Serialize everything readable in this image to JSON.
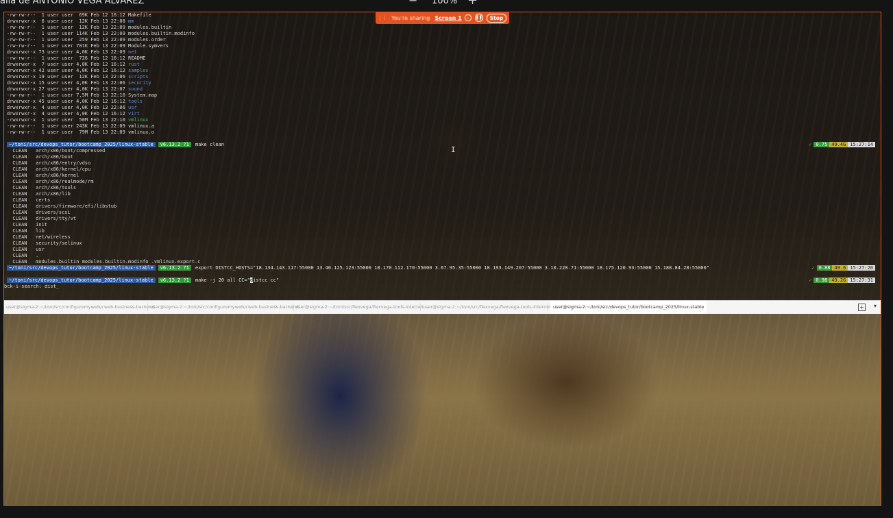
{
  "window": {
    "title": "alla de ANTONIO VEGA ALVAREZ",
    "zoom_minus": "−",
    "zoom_level": "100%",
    "zoom_plus": "+"
  },
  "share_bar": {
    "grip": "⋮⋮",
    "status": "You're sharing",
    "screen": "Screen 1",
    "chevron": "⌄",
    "pause": "❚❚",
    "stop": "Stop"
  },
  "terminal": {
    "listing": [
      {
        "text": "-rw-rw-r--  1 user user  69K Feb 12 16:12 Makefile",
        "kind": "file"
      },
      {
        "text": "drwxrwxr-x  6 user user  12K Feb 13 22:08 ",
        "name": "mm",
        "kind": "dir"
      },
      {
        "text": "-rw-rw-r--  1 user user  12K Feb 13 22:09 modules.builtin",
        "kind": "file"
      },
      {
        "text": "-rw-rw-r--  1 user user 114K Feb 13 22:09 modules.builtin.modinfo",
        "kind": "file"
      },
      {
        "text": "-rw-rw-r--  1 user user  259 Feb 13 22:09 modules.order",
        "kind": "file"
      },
      {
        "text": "-rw-rw-r--  1 user user 701K Feb 13 22:09 Module.symvers",
        "kind": "file"
      },
      {
        "text": "drwxrwxr-x 73 user user 4,0K Feb 13 22:09 ",
        "name": "net",
        "kind": "dir"
      },
      {
        "text": "-rw-rw-r--  1 user user  726 Feb 12 16:12 README",
        "kind": "file"
      },
      {
        "text": "drwxrwxr-x  7 user user 4,0K Feb 12 16:12 ",
        "name": "rust",
        "kind": "dir"
      },
      {
        "text": "drwxrwxr-x 42 user user 4,0K Feb 12 16:12 ",
        "name": "samples",
        "kind": "dir"
      },
      {
        "text": "drwxrwxr-x 19 user user  12K Feb 13 22:06 ",
        "name": "scripts",
        "kind": "dir"
      },
      {
        "text": "drwxrwxr-x 15 user user 4,0K Feb 13 22:06 ",
        "name": "security",
        "kind": "dir"
      },
      {
        "text": "drwxrwxr-x 27 user user 4,0K Feb 13 22:07 ",
        "name": "sound",
        "kind": "dir"
      },
      {
        "text": "-rw-rw-r--  1 user user 7,5M Feb 13 22:10 System.map",
        "kind": "file"
      },
      {
        "text": "drwxrwxr-x 45 user user 4,0K Feb 12 16:12 ",
        "name": "tools",
        "kind": "dir"
      },
      {
        "text": "drwxrwxr-x  4 user user 4,0K Feb 13 22:06 ",
        "name": "usr",
        "kind": "dir"
      },
      {
        "text": "drwxrwxr-x  4 user user 4,0K Feb 12 16:12 ",
        "name": "virt",
        "kind": "dir"
      },
      {
        "text": "-rwxrwxr-x  1 user user  50M Feb 13 22:10 ",
        "name": "vmlinux",
        "kind": "exe"
      },
      {
        "text": "-rw-rw-r--  1 user user 243K Feb 13 22:09 vmlinux.a",
        "kind": "file"
      },
      {
        "text": "-rw-rw-r--  1 user user  79M Feb 13 22:09 vmlinux.o",
        "kind": "file"
      }
    ],
    "prompts": [
      {
        "path": "~/toni/src/devops_tutor/bootcamp_2025/linux-stable",
        "git": "v6.13.2 ?1",
        "cmd": "make clean",
        "ok": "✓",
        "load": "0.75",
        "mem": "49.4G",
        "time": "15:27:14"
      },
      {
        "path": "~/toni/src/devops_tutor/bootcamp_2025/linux-stable",
        "git": "v6.13.2 ?1",
        "cmd": "export DISTCC_HOSTS=\"18.134.143.117:55000 13.40.125.123:55000 18.170.112.170:55000 3.67.95.35:55000 18.193.149.207:55000 3.10.228.71:55000 18.175.120.93:55000 15.188.84.28:55000\"",
        "ok": "✓",
        "load": "0.88",
        "mem": "49.6",
        "time": "15:27:20"
      },
      {
        "path": "~/toni/src/devops_tutor/bootcamp_2025/linux-stable",
        "git": "v6.13.2 ?1",
        "cmd_before": "make -j 20 all CC=\"",
        "cmd_cursor": "d",
        "cmd_after": "istcc cc\"",
        "ok": "✓",
        "load": "0.98",
        "mem": "49.2G",
        "time": "15:27:31"
      }
    ],
    "clean_lines": [
      "  CLEAN   arch/x86/boot/compressed",
      "  CLEAN   arch/x86/boot",
      "  CLEAN   arch/x86/entry/vdso",
      "  CLEAN   arch/x86/kernel/cpu",
      "  CLEAN   arch/x86/kernel",
      "  CLEAN   arch/x86/realmode/rm",
      "  CLEAN   arch/x86/tools",
      "  CLEAN   arch/x86/lib",
      "  CLEAN   certs",
      "  CLEAN   drivers/firmware/efi/libstub",
      "  CLEAN   drivers/scsi",
      "  CLEAN   drivers/tty/vt",
      "  CLEAN   init",
      "  CLEAN   lib",
      "  CLEAN   net/wireless",
      "  CLEAN   security/selinux",
      "  CLEAN   usr",
      "  CLEAN   .",
      "  CLEAN   modules.builtin modules.builtin.modinfo .vmlinux.export.c"
    ],
    "search_line": "bck-i-search: dist_"
  },
  "tabs": [
    {
      "label": "user@sigma-2:~/toni/src/configuremyweb/cweb-business-backend",
      "active": false
    },
    {
      "label": "user@sigma-2:~/toni/src/configuremyweb/cweb-business-backend",
      "active": false
    },
    {
      "label": "user@sigma-2:~/toni/src/flexvega/flexvega-tools-internet",
      "active": false
    },
    {
      "label": "user@sigma-2:~/toni/src/flexvega/flexvega-tools-internet",
      "active": false
    },
    {
      "label": "user@sigma-2:~/toni/src/devops_tutor/bootcamp_2025/linux-stable",
      "active": true
    }
  ],
  "tab_controls": {
    "add": "+",
    "menu": "▾"
  },
  "cursor_glyph": "I"
}
